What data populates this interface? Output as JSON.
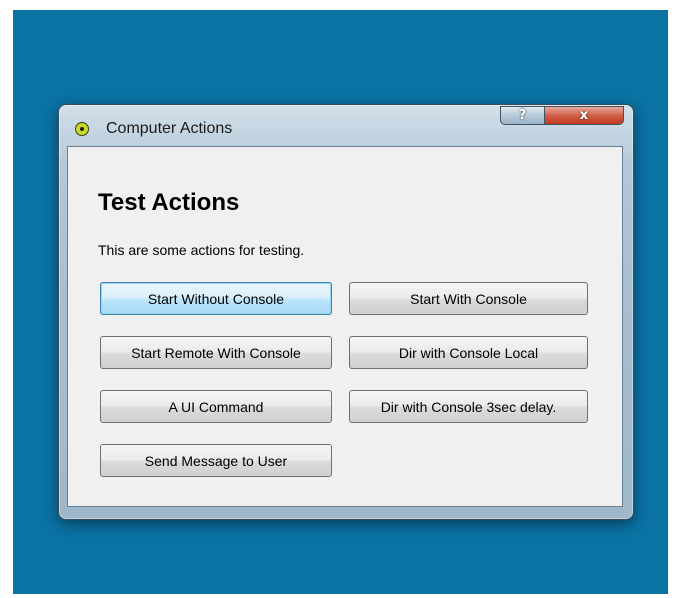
{
  "window": {
    "title": "Computer Actions",
    "help_glyph": "?",
    "close_glyph": "x",
    "app_icon": "app-icon"
  },
  "content": {
    "heading": "Test Actions",
    "description": "This are some actions for testing."
  },
  "buttons": {
    "start_without_console": "Start Without Console",
    "start_with_console": "Start With Console",
    "start_remote_with_console": "Start Remote With Console",
    "dir_with_console_local": "Dir with Console Local",
    "a_ui_command": "A UI Command",
    "dir_with_console_delay": "Dir with Console 3sec delay.",
    "send_message_to_user": "Send Message to User"
  },
  "colors": {
    "desktop": "#0b72a4",
    "close_button": "#c7432a",
    "default_button_border": "#3c7fb1"
  }
}
